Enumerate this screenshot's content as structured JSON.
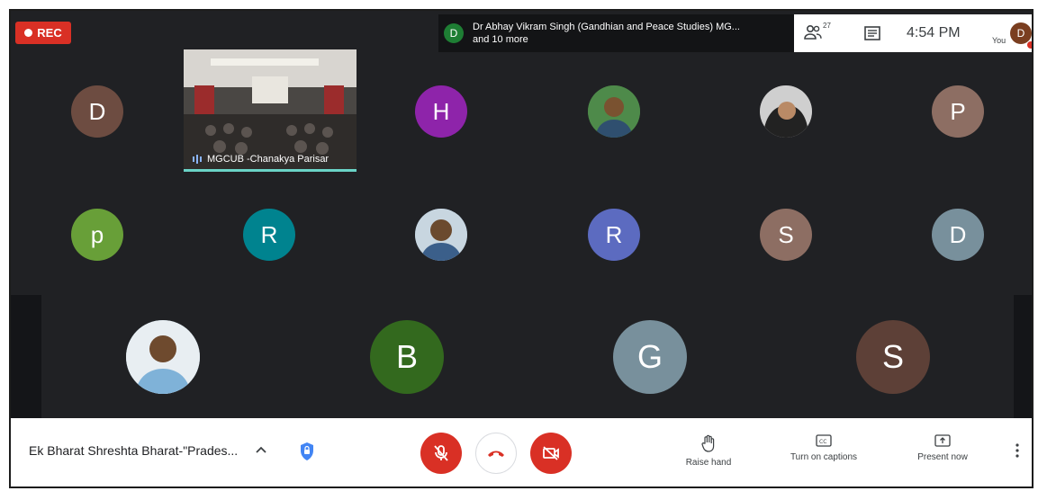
{
  "recording": {
    "label": "REC"
  },
  "speaker": {
    "initial": "D",
    "name": "Dr Abhay Vikram Singh (Gandhian and Peace Studies) MG...",
    "more": "and 10 more"
  },
  "header": {
    "participant_count": "27",
    "time": "4:54 PM",
    "you_label": "You",
    "user_initial": "D"
  },
  "video_tile": {
    "name": "MGCUB -Chanakya Parisar"
  },
  "participants": [
    {
      "initial": "D",
      "color": "#6d4c41"
    },
    {
      "initial": "H",
      "color": "#8e24aa"
    },
    {
      "initial": "",
      "color": "#3b6e3a",
      "photo": true
    },
    {
      "initial": "",
      "color": "#4a4a4a",
      "photo": true
    },
    {
      "initial": "P",
      "color": "#8d6e63"
    },
    {
      "initial": "p",
      "color": "#689f38"
    },
    {
      "initial": "R",
      "color": "#00838f"
    },
    {
      "initial": "",
      "color": "#5a7a9a",
      "photo": true
    },
    {
      "initial": "R",
      "color": "#5c6bc0"
    },
    {
      "initial": "S",
      "color": "#8d6e63"
    },
    {
      "initial": "D",
      "color": "#78909c"
    },
    {
      "initial": "",
      "color": "#a0c4dc",
      "photo": true
    },
    {
      "initial": "B",
      "color": "#33691e"
    },
    {
      "initial": "G",
      "color": "#78909c"
    },
    {
      "initial": "S",
      "color": "#5d4037"
    }
  ],
  "footer": {
    "meeting_title": "Ek Bharat Shreshta Bharat-\"Prades...",
    "raise_hand": "Raise hand",
    "captions": "Turn on captions",
    "present": "Present now"
  },
  "colors": {
    "danger": "#d93025",
    "background": "#202124",
    "accent": "#6ad3c7"
  }
}
